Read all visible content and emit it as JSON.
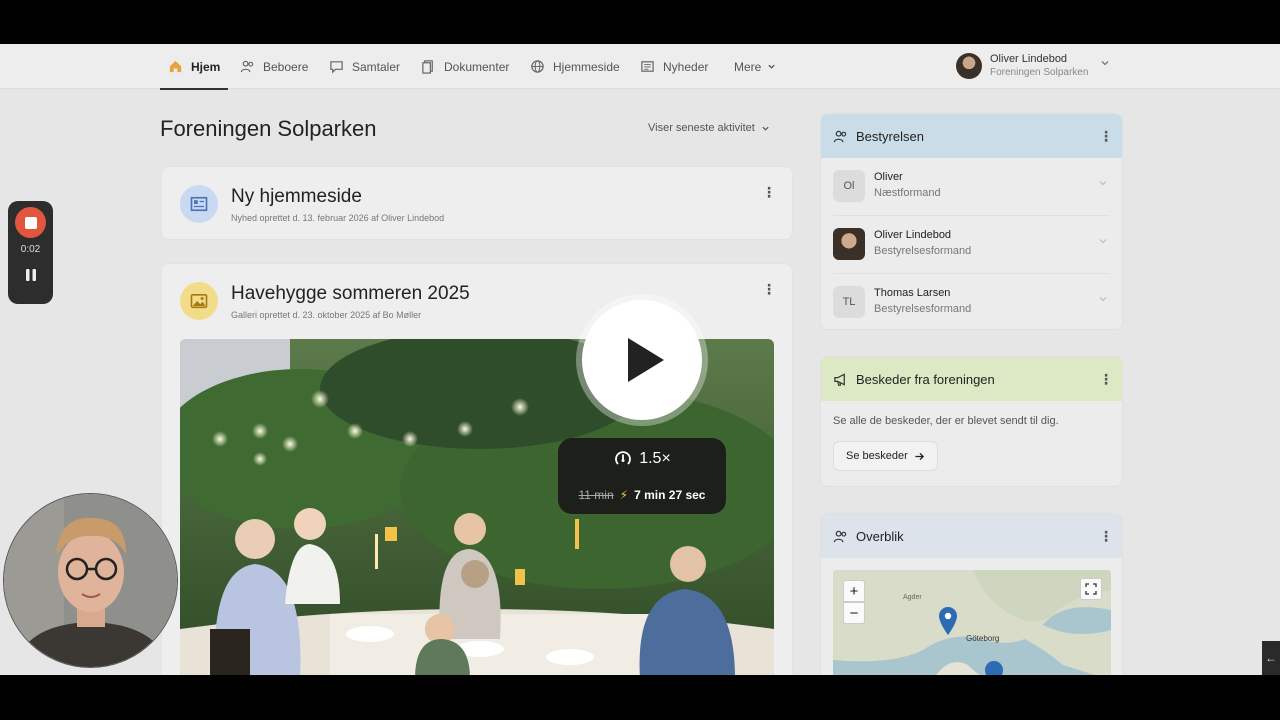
{
  "nav": {
    "items": [
      {
        "label": "Hjem",
        "icon": "home-icon",
        "active": true
      },
      {
        "label": "Beboere",
        "icon": "users-icon"
      },
      {
        "label": "Samtaler",
        "icon": "chat-icon"
      },
      {
        "label": "Dokumenter",
        "icon": "documents-icon"
      },
      {
        "label": "Hjemmeside",
        "icon": "globe-icon"
      },
      {
        "label": "Nyheder",
        "icon": "newspaper-icon"
      },
      {
        "label": "Mere",
        "icon": "chevron-down-icon"
      }
    ],
    "user": {
      "name": "Oliver Lindebod",
      "org": "Foreningen Solparken"
    }
  },
  "main": {
    "title": "Foreningen Solparken",
    "activity_filter": "Viser seneste aktivitet",
    "feed": [
      {
        "title": "Ny hjemmeside",
        "subtitle": "Nyhed oprettet d. 13. februar 2026 af Oliver Lindebod",
        "icon": "newspaper-icon",
        "icon_color": "#c9d9f2"
      },
      {
        "title": "Havehygge sommeren 2025",
        "subtitle": "Galleri oprettet d. 23. oktober 2025 af Bo Møller",
        "icon": "image-icon",
        "icon_color": "#f2dc8a"
      }
    ]
  },
  "sidebar": {
    "board": {
      "title": "Bestyrelsen",
      "header_color": "#c8dde8",
      "members": [
        {
          "initials": "Ol",
          "name": "Oliver",
          "role": "Næstformand"
        },
        {
          "initials": "",
          "name": "Oliver Lindebod",
          "role": "Bestyrelsesformand"
        },
        {
          "initials": "TL",
          "name": "Thomas Larsen",
          "role": "Bestyrelsesformand"
        }
      ]
    },
    "messages": {
      "title": "Beskeder fra foreningen",
      "header_color": "#dde8c4",
      "text": "Se alle de beskeder, der er blevet sendt til dig.",
      "button": "Se beskeder"
    },
    "overview": {
      "title": "Overblik",
      "header_color": "#dde3ea",
      "map_labels": {
        "zoom_in": "+",
        "zoom_out": "−",
        "city": "Göteborg",
        "region": "Agder"
      }
    }
  },
  "overlays": {
    "recorder_time": "0:02",
    "speed": "1.5×",
    "original_duration": "11 min",
    "new_duration": "7 min 27 sec",
    "edge_tab": "←"
  }
}
